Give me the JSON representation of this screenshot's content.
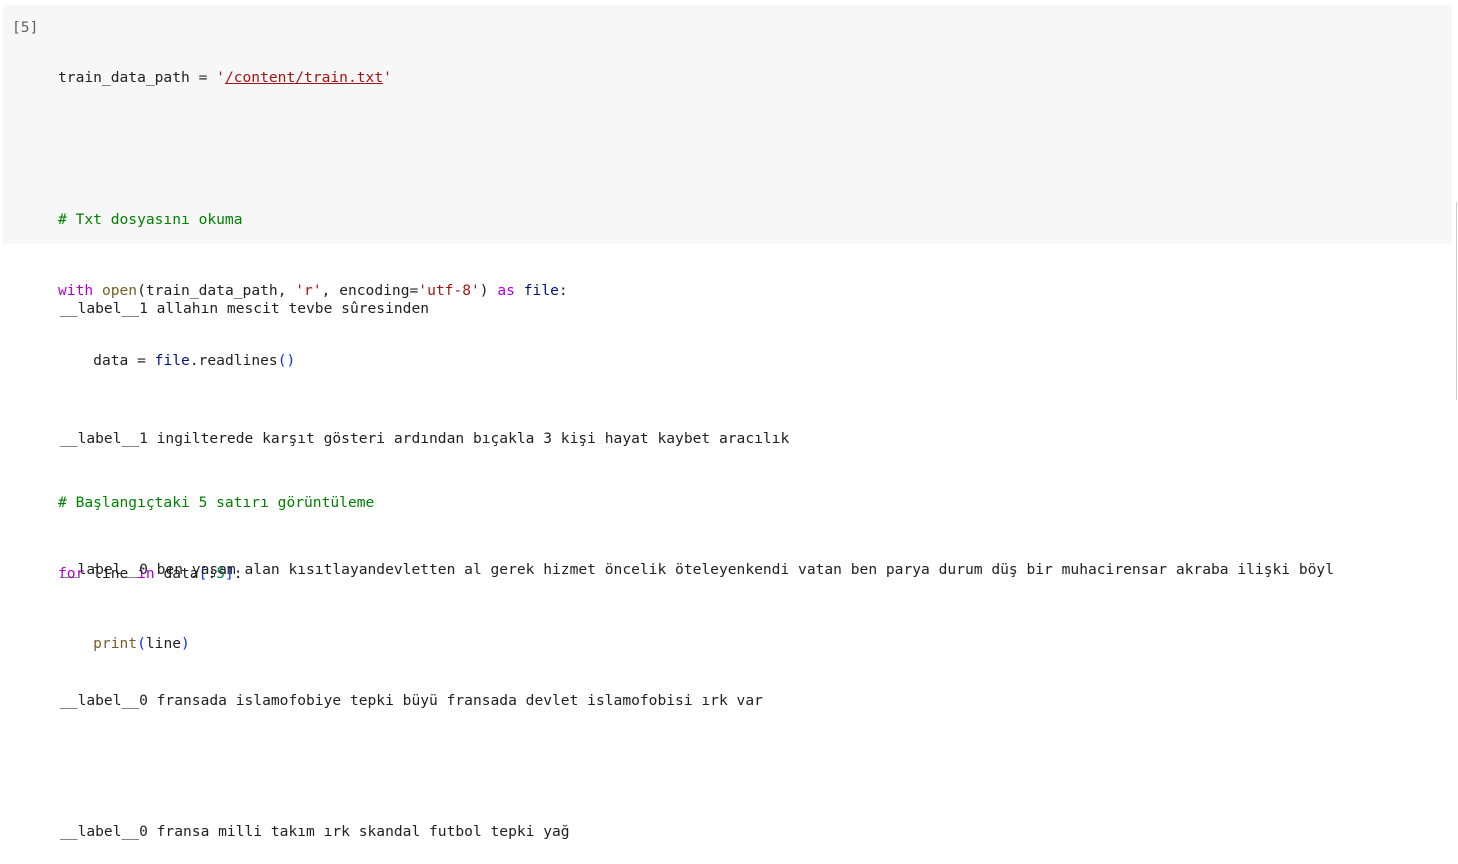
{
  "cell": {
    "execution_count": "[5]",
    "code": {
      "line1": {
        "var": "train_data_path",
        "op": " = ",
        "str_q1": "'",
        "str_path": "/content/train.txt",
        "str_q2": "'"
      },
      "comment1": "# Txt dosyasını okuma",
      "line3": {
        "kw_with": "with",
        "fn_open": "open",
        "p1": "(train_data_path, ",
        "s_r": "'r'",
        "p2": ", encoding=",
        "s_enc": "'utf-8'",
        "p3": ") ",
        "kw_as": "as",
        "p4": " ",
        "var_file": "file",
        "p5": ":"
      },
      "line4": {
        "indent": "    ",
        "p1": "data = ",
        "var_file": "file",
        "p2": ".readlines",
        "paren": "()"
      },
      "comment2": "# Başlangıçtaki 5 satırı görüntüleme",
      "line6": {
        "kw_for": "for",
        "p1": " line ",
        "kw_in": "in",
        "p2": " data",
        "b1": "[",
        "p3": ":",
        "num": "5",
        "b2": "]",
        "p4": ":"
      },
      "line7": {
        "indent": "    ",
        "fn_print": "print",
        "b1": "(",
        "p1": "line",
        "b2": ")"
      }
    }
  },
  "output": {
    "lines": [
      "__label__1 allahın mescit tevbe sûresinden",
      "__label__1 ingilterede karşıt gösteri ardından bıçakla 3 kişi hayat kaybet aracılık",
      "__label__0 ben yaşam alan kısıtlayandevletten al gerek hizmet öncelik öteleyenkendi vatan ben parya durum düş bir muhacirensar akraba ilişki böyl",
      "__label__0 fransada islamofobiye tepki büyü fransada devlet islamofobisi ırk var",
      "__label__0 fransa milli takım ırk skandal futbol tepki yağ"
    ]
  }
}
